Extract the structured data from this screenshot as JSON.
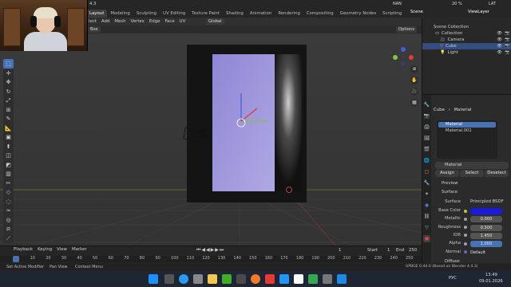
{
  "app": {
    "version_fragment": "4.3",
    "top_right": {
      "stats": "NAN",
      "gpu": "20 %",
      "lat": "LAT",
      "scene_label": "Scene",
      "view_layer": "ViewLayer"
    }
  },
  "workspace_tabs": [
    "Layout",
    "Modeling",
    "Sculpting",
    "UV Editing",
    "Texture Paint",
    "Shading",
    "Animation",
    "Rendering",
    "Compositing",
    "Geometry Nodes",
    "Scripting"
  ],
  "header": {
    "menus": [
      "lect",
      "Add",
      "Mesh",
      "Vertex",
      "Edge",
      "Face",
      "UV"
    ],
    "orientation": "Global",
    "mode_dropdown": "Box",
    "options": "Options"
  },
  "outliner": {
    "title": "Scene Collection",
    "items": [
      {
        "label": "Collection",
        "icon": "collection-icon",
        "color": "#e0e0e0"
      },
      {
        "label": "Camera",
        "icon": "camera-icon",
        "color": "#e0a050"
      },
      {
        "label": "Cube",
        "icon": "mesh-icon",
        "color": "#e0a050"
      },
      {
        "label": "Light",
        "icon": "light-icon",
        "color": "#e0a050"
      }
    ]
  },
  "properties": {
    "breadcrumb": {
      "object": "Cube",
      "sep": "›",
      "material": "Material"
    },
    "slots": [
      "Material",
      "Material.001"
    ],
    "material_name": "Material",
    "buttons": [
      "Assign",
      "Select",
      "Deselect"
    ],
    "sections": {
      "preview": "Preview",
      "surface": "Surface",
      "diffuse": "Diffuse"
    },
    "surface": {
      "label": "Surface",
      "value": "Principled BSDF"
    },
    "fields": [
      {
        "label": "Base Color",
        "value": ""
      },
      {
        "label": "Metallic",
        "value": "0.000"
      },
      {
        "label": "Roughness",
        "value": "0.500"
      },
      {
        "label": "IOR",
        "value": "1.450"
      },
      {
        "label": "Alpha",
        "value": "1.000"
      },
      {
        "label": "Normal",
        "value": "Default"
      }
    ],
    "base_color_hex": "#1a1adf"
  },
  "timeline": {
    "menus": [
      "Playback",
      "Keying",
      "View",
      "Marker"
    ],
    "current_frame": "1",
    "start_label": "Start",
    "start": "1",
    "end_label": "End",
    "end": "250",
    "ruler": [
      "1",
      "10",
      "20",
      "30",
      "40",
      "50",
      "60",
      "70",
      "80",
      "90",
      "100",
      "110",
      "120",
      "130",
      "140",
      "150",
      "160",
      "170",
      "180",
      "190",
      "200",
      "210",
      "220",
      "230",
      "240",
      "250"
    ]
  },
  "statusbar": {
    "left1": "Set Active Modifier",
    "left2": "Pan View",
    "left3": "Context Menu",
    "right": "UPBGE 0.44.0 (Based on Blender 4.4.3)"
  },
  "taskbar": {
    "lang": "РУС",
    "time": "13:49",
    "date": "09.01.2026"
  },
  "colors": {
    "accent": "#4772b3",
    "active_tab": "#3d3d3d",
    "selected_row": "#334d80",
    "door_frame": "#161616",
    "panel": "#9c93d8"
  }
}
